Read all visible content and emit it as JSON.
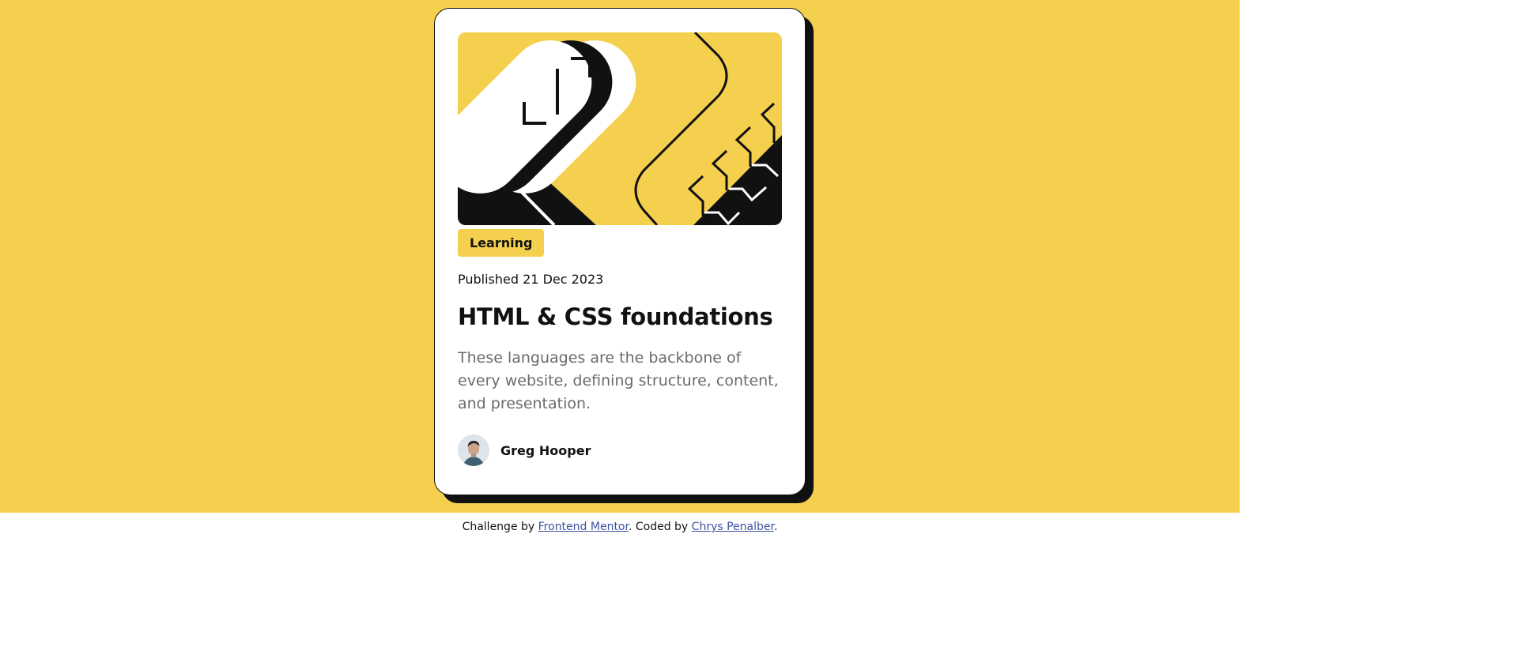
{
  "card": {
    "tag": "Learning",
    "published": "Published 21 Dec 2023",
    "title": "HTML & CSS foundations",
    "description": "These languages are the backbone of every website, defining structure, content, and presentation.",
    "author": {
      "name": "Greg Hooper",
      "avatar_icon": "avatar-photo"
    },
    "hero_illustration": "abstract-geometric-illustration"
  },
  "footer": {
    "prefix": "Challenge by ",
    "link1": "Frontend Mentor",
    "middle": ". Coded by ",
    "link2": "Chrys Penalber",
    "suffix": "."
  },
  "colors": {
    "background": "#f4d04e",
    "card": "#ffffff",
    "ink": "#111111",
    "muted_text": "#6b6b6b",
    "link": "#3e52a3"
  }
}
